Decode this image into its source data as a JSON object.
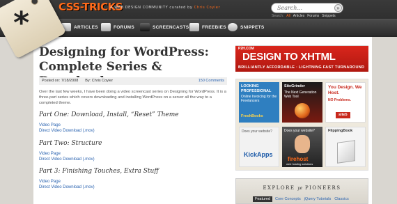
{
  "header": {
    "logo": "CSS-TRICKS",
    "tagline_prefix": "A WEB DESIGN COMMUNITY curated by",
    "tagline_author": "Chris Coyier",
    "search_placeholder": "Search...",
    "search_button": "»",
    "search_scope": {
      "label": "Search:",
      "items": [
        "All",
        "Articles",
        "Forums",
        "Snippets"
      ],
      "active": "All"
    },
    "nav": [
      {
        "label": "ARTICLES",
        "icon": "articles-icon"
      },
      {
        "label": "FORUMS",
        "icon": "forums-icon"
      },
      {
        "label": "SCREENCASTS",
        "icon": "screencasts-icon"
      },
      {
        "label": "FREEBIES",
        "icon": "freebies-icon"
      },
      {
        "label": "SNIPPETS",
        "icon": "snippets-icon"
      }
    ]
  },
  "post": {
    "title": "Designing for WordPress: Complete Series & Downloads",
    "posted_label": "Posted on: 7/18/2008",
    "author_label": "By: Chris Coyier",
    "comments": "150 Comments",
    "intro": "Over the last few weeks, I have been doing a video screencast series on Designing for WordPress. It is a three-part series which covers downloading and installing WordPress on a server all the way to a completed theme.",
    "parts": [
      {
        "title": "Part One: Download, Install, “Reset” Theme",
        "links": [
          "Video Page",
          "Direct Video Download (.mov)"
        ]
      },
      {
        "title": "Part Two: Structure",
        "links": [
          "Video Page",
          "Direct Video Download (.mov)"
        ]
      },
      {
        "title": "Part 3: Finishing Touches, Extra Stuff",
        "links": [
          "Video Page",
          "Direct Video Download (.mov)"
        ]
      }
    ]
  },
  "sidebar": {
    "banner": {
      "brand": "P2H.COM",
      "headline": "DESIGN TO XHTML",
      "subline": "BRILLIANTLY AFFORDABLE · LIGHTNING FAST TURNAROUND"
    },
    "ads": [
      {
        "line1": "LOOKING PROFESSIONAL",
        "line2": "Online Invoicing for the Freelancers",
        "brand": "FreshBooks",
        "bg": "#2f7fc0"
      },
      {
        "line1": "SiteGrinder",
        "line2": "The Next Generation Web Tool",
        "brand": "",
        "bg": "#7a1a10"
      },
      {
        "line1": "You Design. We Host.",
        "line2": "NO Problems.",
        "brand": "site5",
        "bg": "#c8281c"
      },
      {
        "line1": "Does your website?",
        "line2": "",
        "brand": "KickApps",
        "bg": "#f2f2f2"
      },
      {
        "line1": "Does your website?",
        "line2": "web hosting solutions",
        "brand": "firehost",
        "bg": "#3a3a3a"
      },
      {
        "line1": "FlippingBook",
        "line2": "",
        "brand": "",
        "bg": "#f4f4f4"
      }
    ],
    "explore": {
      "title_a": "EXPLORE",
      "title_em": "ye",
      "title_b": "PIONEERS",
      "tabs": [
        "Featured",
        "Core Concepts",
        "jQuery Tutorials",
        "Classics"
      ],
      "active_tab": "Featured"
    }
  },
  "colors": {
    "accent": "#ff6a1a",
    "link": "#2a63b0",
    "banner_red": "#c8281c",
    "header_dark": "#2c2c2c"
  }
}
